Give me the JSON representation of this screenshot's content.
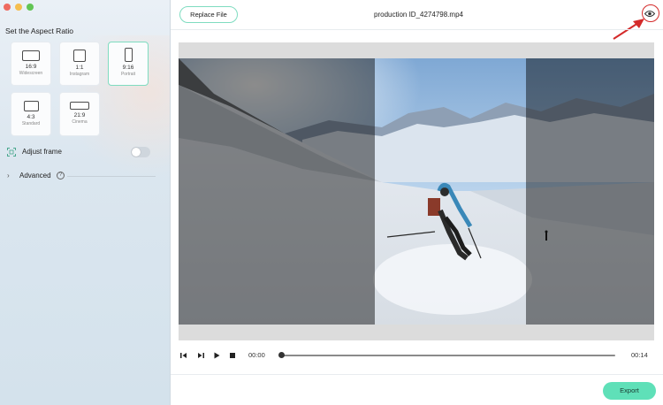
{
  "window": {
    "controls": [
      "close",
      "minimize",
      "zoom"
    ]
  },
  "sidebar": {
    "section_title": "Set the Aspect Ratio",
    "ratios": [
      {
        "ratio": "16:9",
        "name": "Widescreen",
        "selected": false
      },
      {
        "ratio": "1:1",
        "name": "Instagram",
        "selected": false
      },
      {
        "ratio": "9:16",
        "name": "Portrait",
        "selected": true
      },
      {
        "ratio": "4:3",
        "name": "Standard",
        "selected": false
      },
      {
        "ratio": "21:9",
        "name": "Cinema",
        "selected": false
      }
    ],
    "adjust_frame_label": "Adjust frame",
    "adjust_frame_on": false,
    "advanced_label": "Advanced",
    "help_glyph": "?"
  },
  "header": {
    "replace_button": "Replace File",
    "file_name": "production ID_4274798.mp4",
    "preview_icon": "eye-icon"
  },
  "player": {
    "current_time": "00:00",
    "total_time": "00:14",
    "progress": 0,
    "buttons": [
      "prev-frame-icon",
      "next-frame-icon",
      "play-icon",
      "stop-icon"
    ]
  },
  "footer": {
    "export_button": "Export"
  },
  "colors": {
    "accent": "#5fe0b8",
    "accent_border": "#7fdcc0",
    "annotation_red": "#d42a2a"
  }
}
